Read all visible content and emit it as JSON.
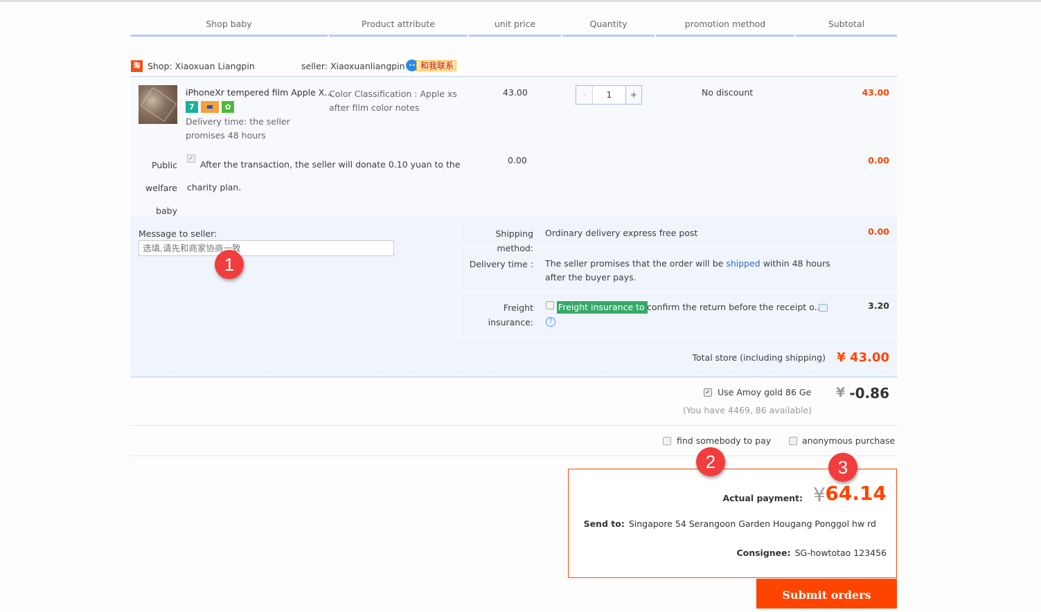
{
  "header": {
    "columns": [
      "Shop baby",
      "Product attribute",
      "unit price",
      "Quantity",
      "promotion method",
      "Subtotal"
    ]
  },
  "shop": {
    "icon": "taobao-icon",
    "icon_glyph": "淘",
    "shop_label": "Shop:  Xiaoxuan Liangpin",
    "seller_label": "seller:  Xiaoxuanliangpin",
    "contact_label": "和我联系"
  },
  "product": {
    "title": "iPhoneXr tempered film Apple X...",
    "badge_7": "7",
    "delivery": "Delivery time: the seller promises 48 hours",
    "attribute": "Color Classification : Apple xs after film color notes",
    "unit_price": "43.00",
    "quantity": "1",
    "qty_minus": "-",
    "qty_plus": "+",
    "promotion": "No discount",
    "subtotal": "43.00"
  },
  "welfare": {
    "label": "Public welfare baby",
    "text": "After the transaction, the seller will donate 0.10 yuan to the charity plan.",
    "price": "0.00",
    "subtotal": "0.00"
  },
  "message": {
    "label": "Message to seller:",
    "placeholder": "选填,请先和商家协商一致"
  },
  "shipping": {
    "method_label": "Shipping method:",
    "method_value": "Ordinary delivery  express free post",
    "method_price": "0.00",
    "time_label": "Delivery time :",
    "time_before": "The seller promises that the order will be ",
    "time_link": "shipped",
    "time_after": " within 48 hours after the buyer pays.",
    "insurance_label": "Freight insurance:",
    "insurance_tag": "Freight insurance to",
    "insurance_text": "confirm the return before the receipt o...",
    "insurance_price": "3.20",
    "help_glyph": "?"
  },
  "total": {
    "label": "Total store (including shipping)",
    "value": "¥ 43.00"
  },
  "gold": {
    "label": "Use Amoy gold 86 Ge",
    "checked": true,
    "yen": "¥",
    "value": "-0.86",
    "available": "(You have 4469, 86 available)"
  },
  "options": {
    "find_pay": "find somebody to pay",
    "anonymous": "anonymous purchase"
  },
  "payment": {
    "actual_label": "Actual payment:",
    "yen": "¥",
    "actual_value": "64.14",
    "send_label": "Send to:",
    "send_value": "Singapore   54 Serangoon Garden Hougang Ponggol   hw rd",
    "consignee_label": "Consignee:",
    "consignee_value": "SG-howtotao   123456",
    "submit_label": "Submit orders"
  },
  "markers": [
    "1",
    "2",
    "3"
  ],
  "colors": {
    "accent": "#ff4400",
    "header_border": "#b2cdf5",
    "link": "#3266cc",
    "insurance_green": "#36a967"
  }
}
